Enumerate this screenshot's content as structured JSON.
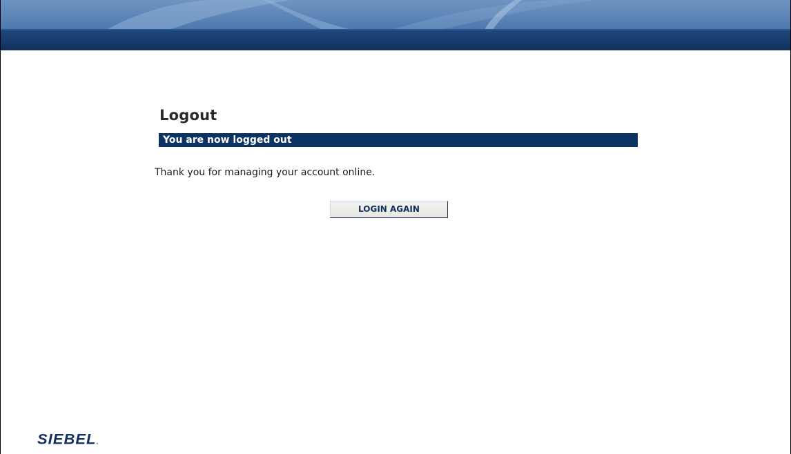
{
  "banner": {
    "colors": {
      "top": "#5f87b7",
      "band": "#163b6e"
    }
  },
  "main": {
    "title": "Logout",
    "status": "You are now logged out",
    "message": "Thank you for managing your account online.",
    "login_again_label": "LOGIN AGAIN"
  },
  "footer": {
    "logo_text": "SIEBEL",
    "logo_dot": "."
  },
  "colors": {
    "status_bar": "#0d3362",
    "logo": "#13305e"
  }
}
